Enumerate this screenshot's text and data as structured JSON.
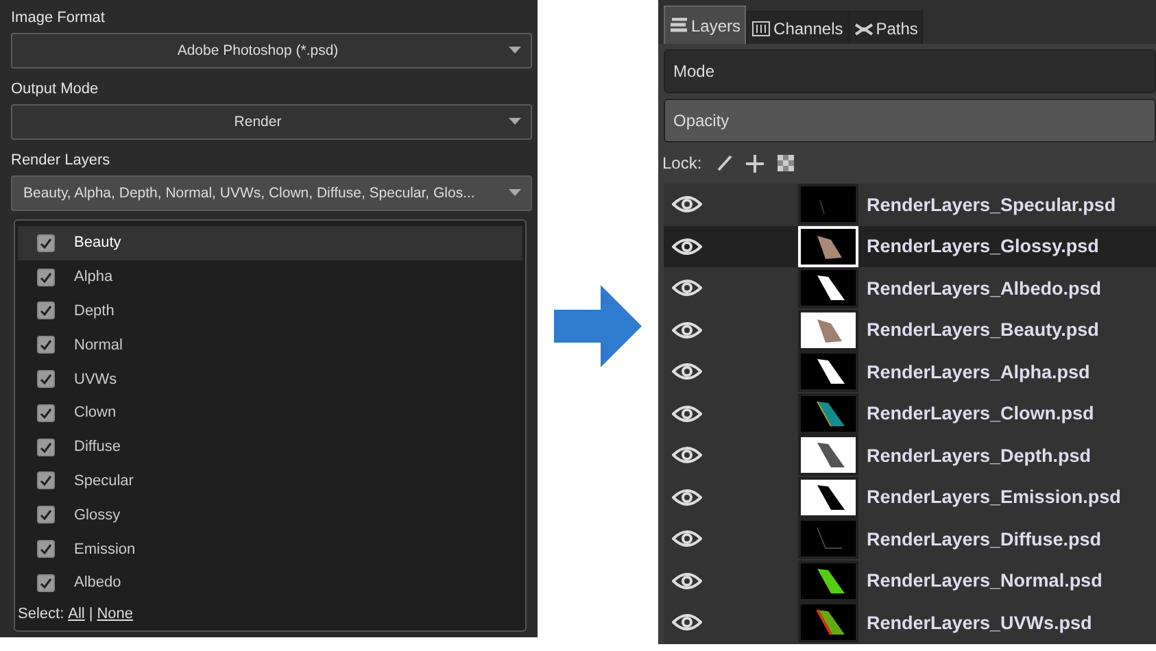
{
  "render_settings": {
    "image_format": {
      "label": "Image Format",
      "value": "Adobe Photoshop (*.psd)"
    },
    "output_mode": {
      "label": "Output Mode",
      "value": "Render"
    },
    "render_layers": {
      "label": "Render Layers",
      "value": "Beauty, Alpha, Depth, Normal, UVWs, Clown, Diffuse, Specular, Glos...",
      "options": [
        {
          "label": "Beauty",
          "checked": true,
          "selected": true
        },
        {
          "label": "Alpha",
          "checked": true,
          "selected": false
        },
        {
          "label": "Depth",
          "checked": true,
          "selected": false
        },
        {
          "label": "Normal",
          "checked": true,
          "selected": false
        },
        {
          "label": "UVWs",
          "checked": true,
          "selected": false
        },
        {
          "label": "Clown",
          "checked": true,
          "selected": false
        },
        {
          "label": "Diffuse",
          "checked": true,
          "selected": false
        },
        {
          "label": "Specular",
          "checked": true,
          "selected": false
        },
        {
          "label": "Glossy",
          "checked": true,
          "selected": false
        },
        {
          "label": "Emission",
          "checked": true,
          "selected": false
        },
        {
          "label": "Albedo",
          "checked": true,
          "selected": false
        }
      ],
      "select": {
        "label": "Select:",
        "all": "All",
        "separator": "|",
        "none": "None"
      }
    }
  },
  "layers_panel": {
    "tabs": [
      {
        "label": "Layers",
        "selected": true
      },
      {
        "label": "Channels",
        "selected": false
      },
      {
        "label": "Paths",
        "selected": false
      }
    ],
    "mode": {
      "label": "Mode"
    },
    "opacity": {
      "label": "Opacity"
    },
    "lock": {
      "label": "Lock:"
    },
    "layers": [
      {
        "name": "RenderLayers_Specular.psd",
        "visible": true,
        "selected": false,
        "kind": "specular"
      },
      {
        "name": "RenderLayers_Glossy.psd",
        "visible": true,
        "selected": true,
        "kind": "glossy"
      },
      {
        "name": "RenderLayers_Albedo.psd",
        "visible": true,
        "selected": false,
        "kind": "mask"
      },
      {
        "name": "RenderLayers_Beauty.psd",
        "visible": true,
        "selected": false,
        "kind": "beauty"
      },
      {
        "name": "RenderLayers_Alpha.psd",
        "visible": true,
        "selected": false,
        "kind": "mask"
      },
      {
        "name": "RenderLayers_Clown.psd",
        "visible": true,
        "selected": false,
        "kind": "clown"
      },
      {
        "name": "RenderLayers_Depth.psd",
        "visible": true,
        "selected": false,
        "kind": "depth"
      },
      {
        "name": "RenderLayers_Emission.psd",
        "visible": true,
        "selected": false,
        "kind": "emission"
      },
      {
        "name": "RenderLayers_Diffuse.psd",
        "visible": true,
        "selected": false,
        "kind": "diffuse"
      },
      {
        "name": "RenderLayers_Normal.psd",
        "visible": true,
        "selected": false,
        "kind": "normal"
      },
      {
        "name": "RenderLayers_UVWs.psd",
        "visible": true,
        "selected": false,
        "kind": "uvws"
      }
    ]
  }
}
